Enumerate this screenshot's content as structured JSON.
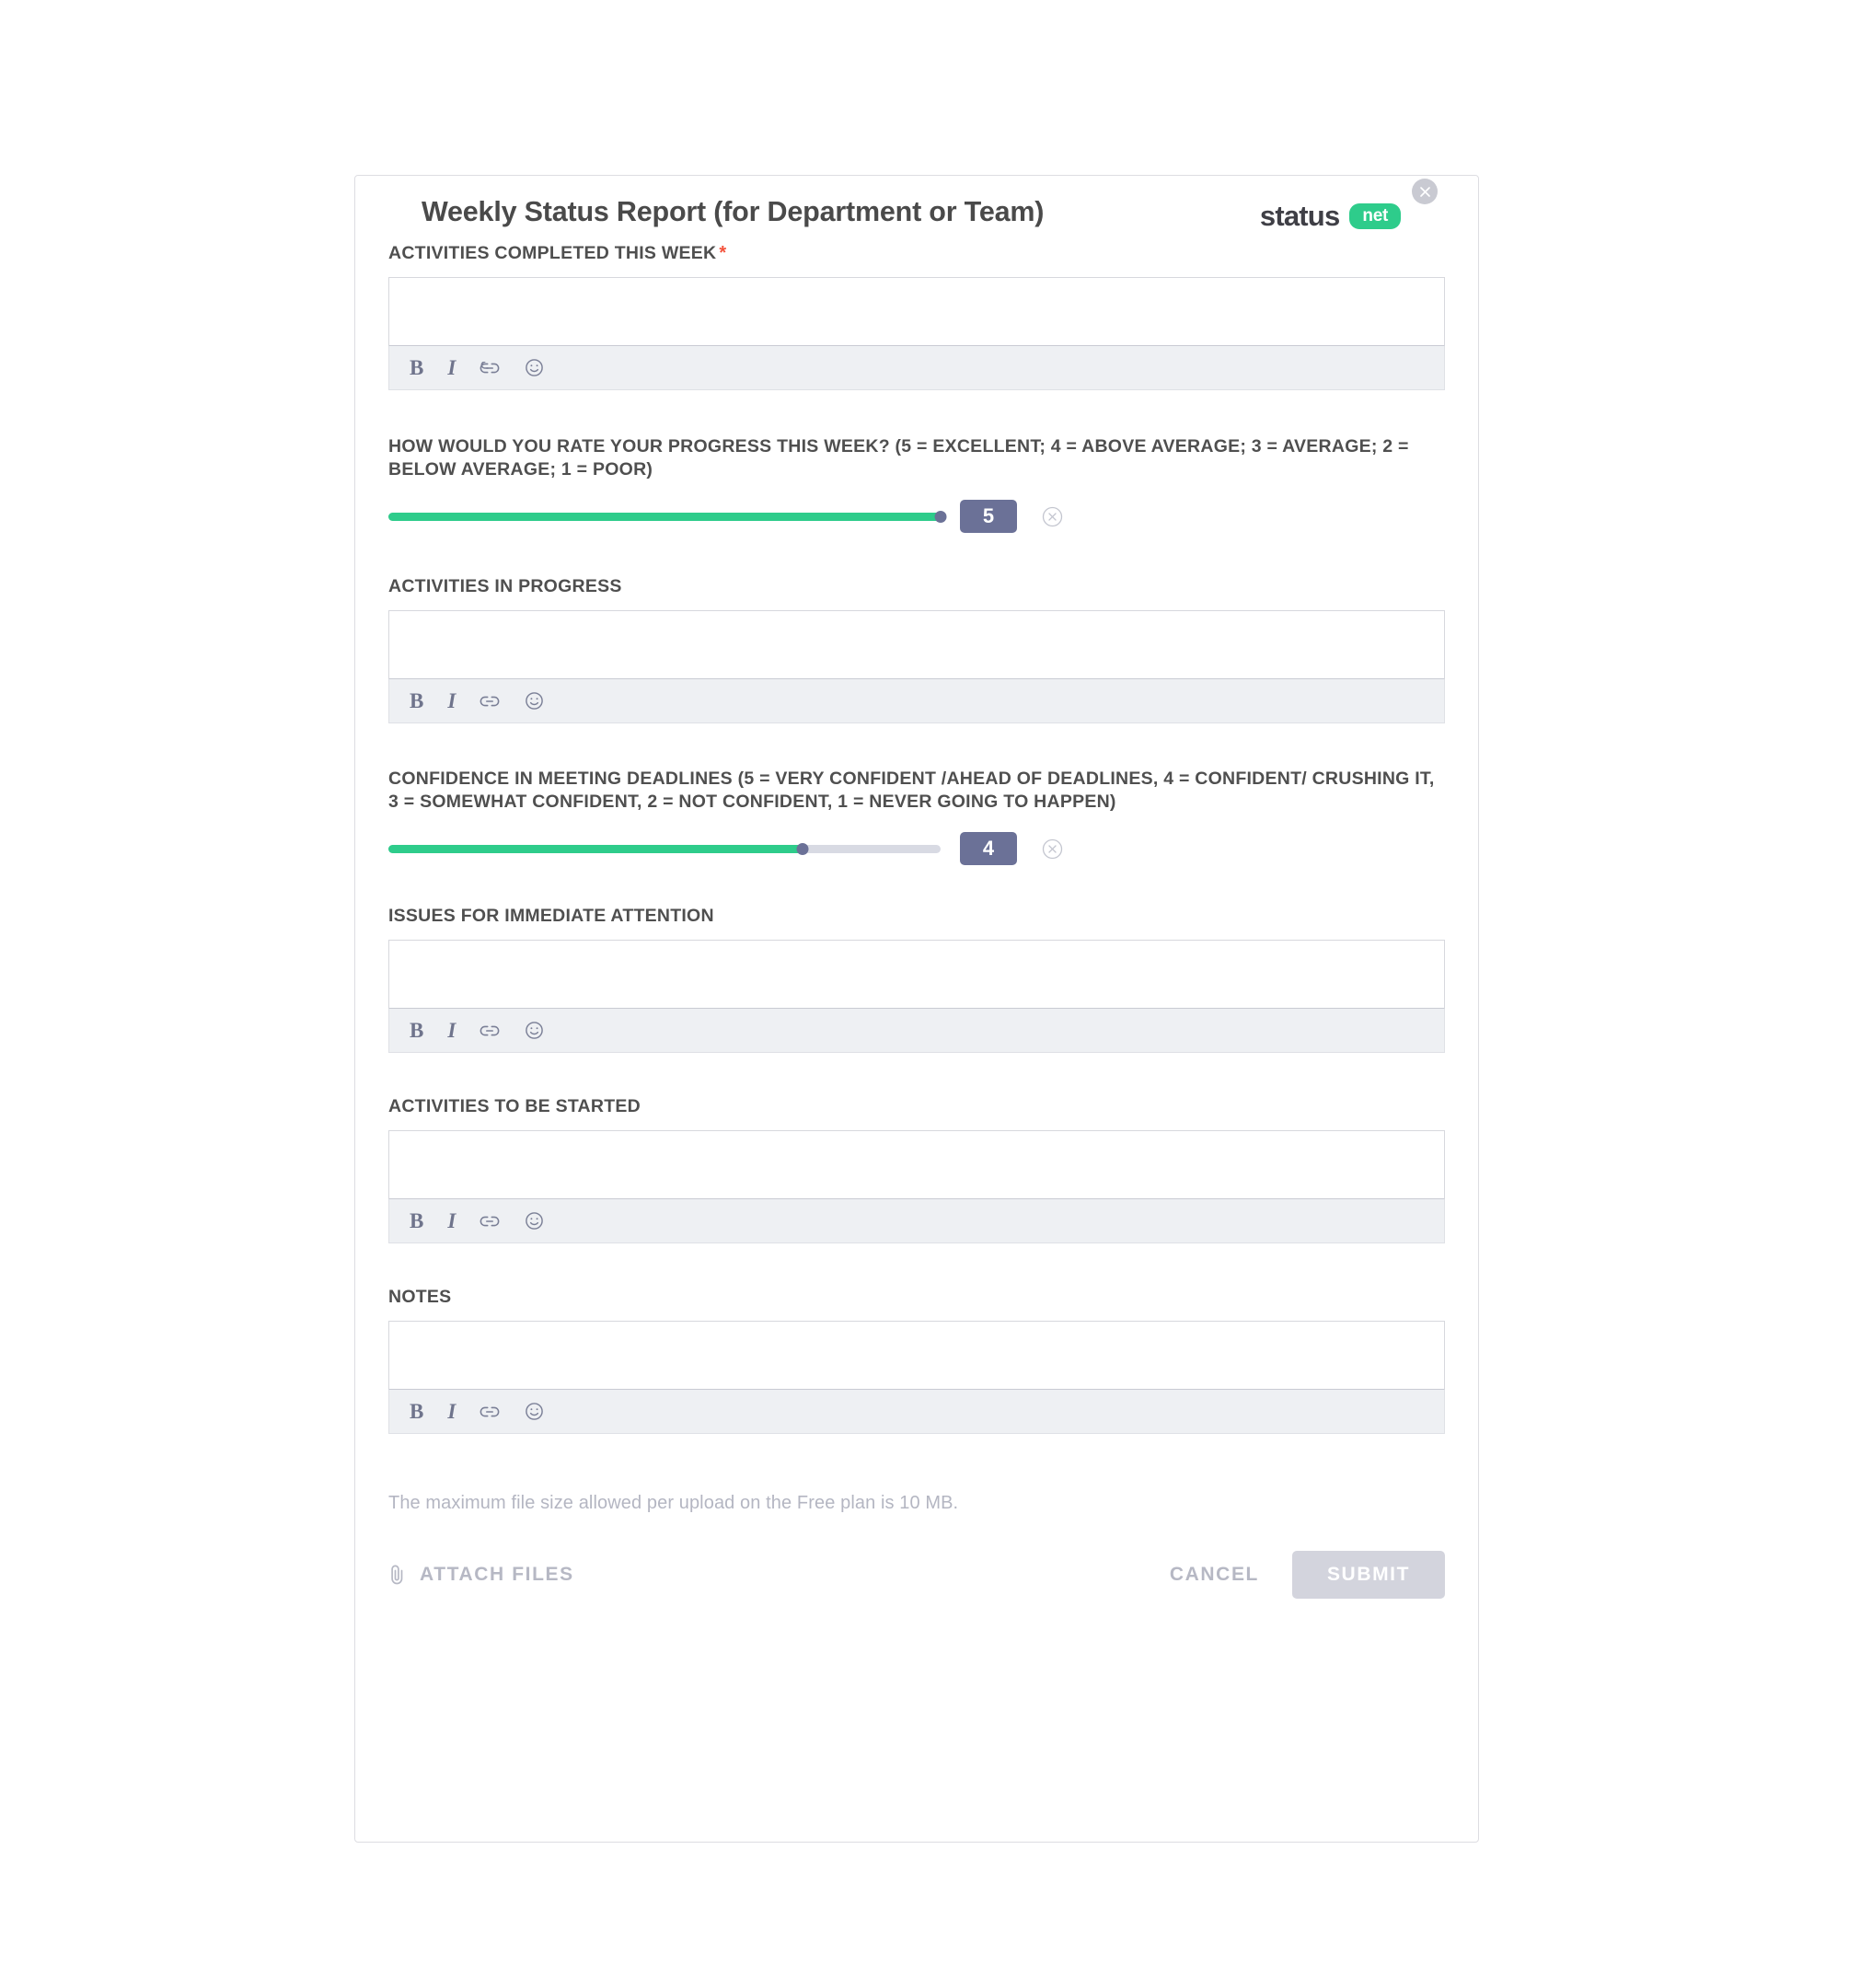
{
  "header": {
    "title": "Weekly Status Report (for Department or Team)",
    "brand_word": "status",
    "brand_pill": "net",
    "close_icon": "close-icon"
  },
  "colors": {
    "accent_green": "#2ecc8b",
    "badge_slate": "#6b7197",
    "required_star": "#f4523b",
    "toolbar_bg": "#eef0f3",
    "submit_disabled": "#d3d4dd"
  },
  "toolbar_icons": [
    {
      "name": "bold-icon",
      "glyph": "B"
    },
    {
      "name": "italic-icon",
      "glyph": "I"
    },
    {
      "name": "link-icon",
      "glyph": "link"
    },
    {
      "name": "emoji-icon",
      "glyph": "smiley"
    }
  ],
  "fields": [
    {
      "label": "ACTIVITIES COMPLETED THIS WEEK",
      "required": true,
      "star": "*",
      "type": "richtext",
      "value": ""
    },
    {
      "label": "HOW WOULD YOU RATE YOUR PROGRESS THIS WEEK? (5 = EXCELLENT; 4 = ABOVE AVERAGE; 3 = AVERAGE; 2 = BELOW AVERAGE; 1 = POOR)",
      "required": false,
      "type": "slider",
      "value": "5",
      "min": 1,
      "max": 5,
      "fill_percent": 100
    },
    {
      "label": "ACTIVITIES IN PROGRESS",
      "required": false,
      "type": "richtext",
      "value": ""
    },
    {
      "label": "CONFIDENCE IN MEETING DEADLINES (5 = VERY CONFIDENT /AHEAD OF DEADLINES, 4 = CONFIDENT/ CRUSHING IT, 3 = SOMEWHAT CONFIDENT, 2 = NOT CONFIDENT, 1 = NEVER GOING TO HAPPEN)",
      "required": false,
      "type": "slider",
      "value": "4",
      "min": 1,
      "max": 5,
      "fill_percent": 75
    },
    {
      "label": "ISSUES FOR IMMEDIATE ATTENTION",
      "required": false,
      "type": "richtext",
      "value": ""
    },
    {
      "label": "ACTIVITIES TO BE STARTED",
      "required": false,
      "type": "richtext",
      "value": ""
    },
    {
      "label": "NOTES",
      "required": false,
      "type": "richtext",
      "value": ""
    }
  ],
  "footer": {
    "file_note": "The maximum file size allowed per upload on the Free plan is 10 MB.",
    "attach_label": "ATTACH FILES",
    "attach_icon": "paperclip-icon",
    "cancel_label": "CANCEL",
    "submit_label": "SUBMIT"
  }
}
